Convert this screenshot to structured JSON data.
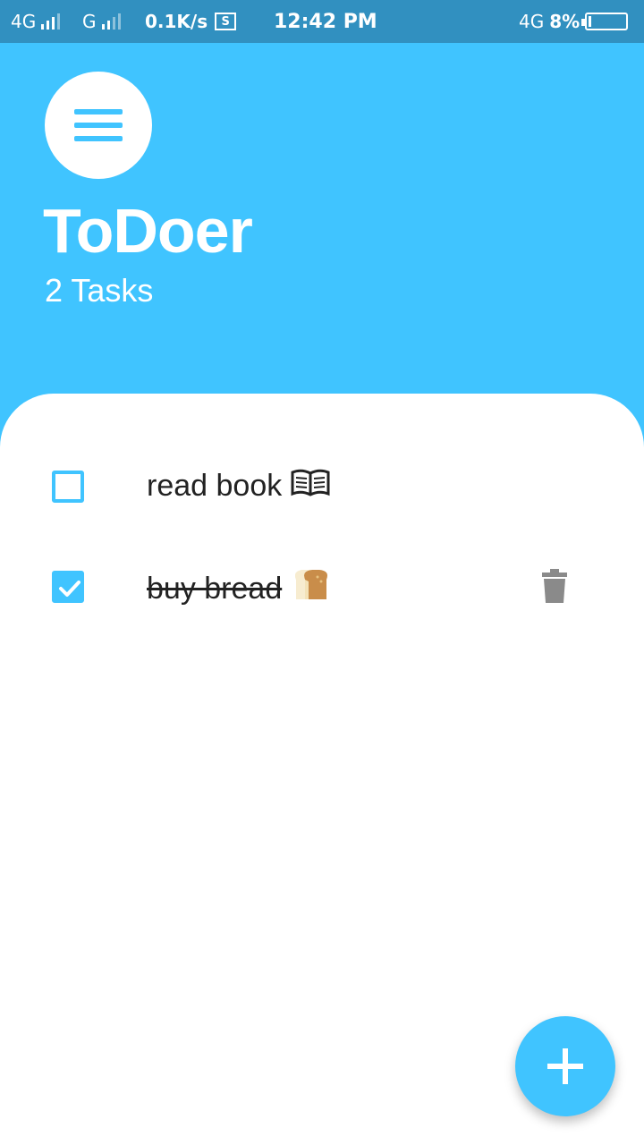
{
  "status_bar": {
    "network1": "4G",
    "network2": "G",
    "speed": "0.1K/s",
    "sim_label": "S",
    "time": "12:42 PM",
    "network3": "4G",
    "battery": "8%",
    "battery_level": 0.08
  },
  "header": {
    "menu_icon": "menu-icon",
    "title": "ToDoer",
    "task_count": "2 Tasks"
  },
  "tasks": [
    {
      "label": "read book",
      "emoji": "book-icon",
      "done": false
    },
    {
      "label": "buy bread",
      "emoji": "bread-icon",
      "done": true,
      "delete_icon": "trash-icon"
    }
  ],
  "fab": {
    "icon": "plus-icon"
  },
  "colors": {
    "accent": "#40c4ff",
    "status_bar": "#3190c0",
    "text": "#222222",
    "trash": "#8a8a8a"
  }
}
